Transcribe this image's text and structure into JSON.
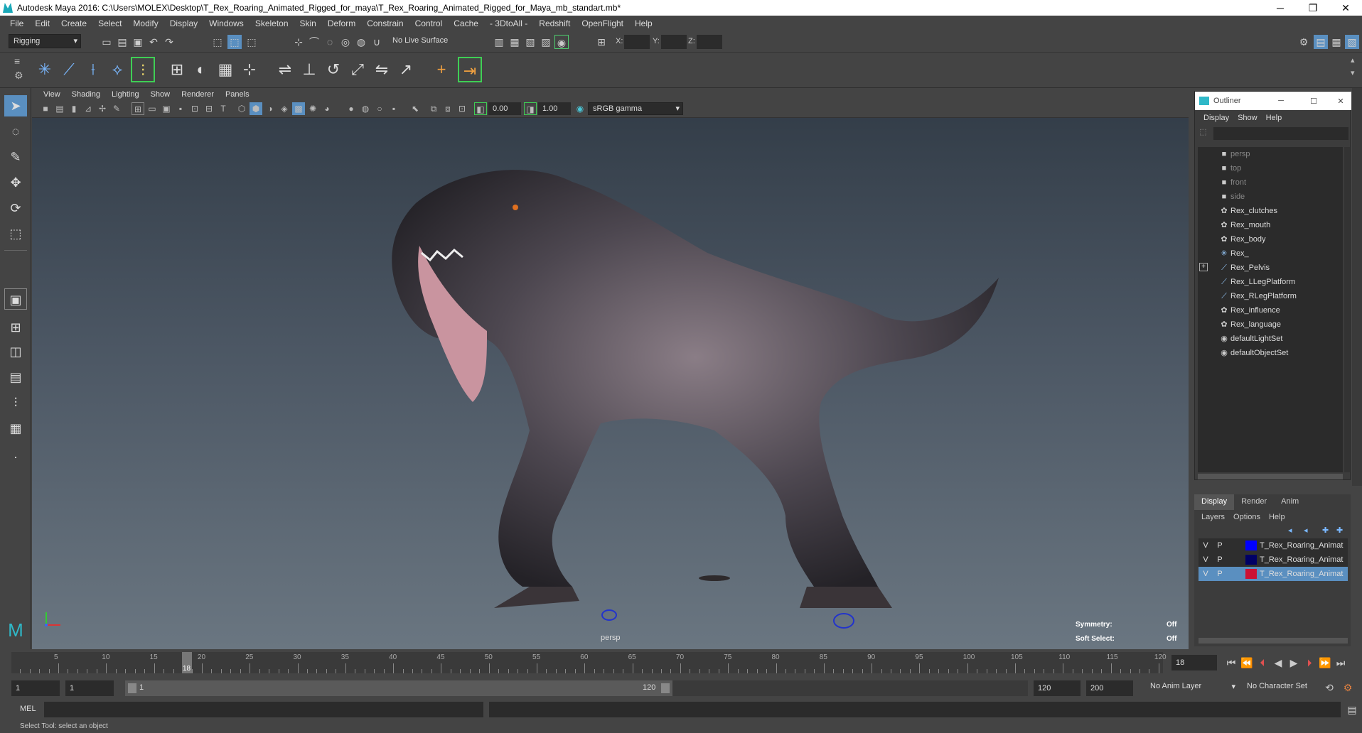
{
  "window": {
    "title": "Autodesk Maya 2016: C:\\Users\\MOLEX\\Desktop\\T_Rex_Roaring_Animated_Rigged_for_maya\\T_Rex_Roaring_Animated_Rigged_for_Maya_mb_standart.mb*",
    "minimize": "─",
    "restore": "❐",
    "close": "✕"
  },
  "menubar": [
    "File",
    "Edit",
    "Create",
    "Select",
    "Modify",
    "Display",
    "Windows",
    "Skeleton",
    "Skin",
    "Deform",
    "Constrain",
    "Control",
    "Cache",
    "- 3DtoAll -",
    "Redshift",
    "OpenFlight",
    "Help"
  ],
  "statusline": {
    "mode": "Rigging",
    "live_surface": "No Live Surface",
    "x_label": "X:",
    "y_label": "Y:",
    "z_label": "Z:"
  },
  "panel": {
    "menus": [
      "View",
      "Shading",
      "Lighting",
      "Show",
      "Renderer",
      "Panels"
    ],
    "exposure": "0.00",
    "gamma": "1.00",
    "color_space": "sRGB gamma",
    "camera_label": "persp",
    "symmetry_label": "Symmetry:",
    "symmetry_value": "Off",
    "soft_select_label": "Soft Select:",
    "soft_select_value": "Off"
  },
  "outliner": {
    "title": "Outliner",
    "menus": [
      "Display",
      "Show",
      "Help"
    ],
    "items": [
      {
        "label": "persp",
        "icon": "camera-icon",
        "dim": true
      },
      {
        "label": "top",
        "icon": "camera-icon",
        "dim": true
      },
      {
        "label": "front",
        "icon": "camera-icon",
        "dim": true
      },
      {
        "label": "side",
        "icon": "camera-icon",
        "dim": true
      },
      {
        "label": "Rex_clutches",
        "icon": "mesh-icon",
        "dim": false
      },
      {
        "label": "Rex_mouth",
        "icon": "mesh-icon",
        "dim": false
      },
      {
        "label": "Rex_body",
        "icon": "mesh-icon",
        "dim": false
      },
      {
        "label": "Rex_",
        "icon": "locator-icon",
        "dim": false
      },
      {
        "label": "Rex_Pelvis",
        "icon": "joint-icon",
        "dim": false,
        "expand": "+"
      },
      {
        "label": "Rex_LLegPlatform",
        "icon": "joint-icon",
        "dim": false
      },
      {
        "label": "Rex_RLegPlatform",
        "icon": "joint-icon",
        "dim": false
      },
      {
        "label": "Rex_influence",
        "icon": "mesh-icon",
        "dim": false
      },
      {
        "label": "Rex_language",
        "icon": "mesh-icon",
        "dim": false
      },
      {
        "label": "defaultLightSet",
        "icon": "set-icon",
        "dim": false
      },
      {
        "label": "defaultObjectSet",
        "icon": "set-icon",
        "dim": false
      }
    ]
  },
  "layers": {
    "tabs": [
      "Display",
      "Render",
      "Anim"
    ],
    "menus": [
      "Layers",
      "Options",
      "Help"
    ],
    "rows": [
      {
        "v": "V",
        "p": "P",
        "color": "#0000ff",
        "name": "T_Rex_Roaring_Animat",
        "selected": false
      },
      {
        "v": "V",
        "p": "P",
        "color": "#000066",
        "name": "T_Rex_Roaring_Animat",
        "selected": false
      },
      {
        "v": "V",
        "p": "P",
        "color": "#cc1133",
        "name": "T_Rex_Roaring_Animat",
        "selected": true
      }
    ]
  },
  "timeline": {
    "ticks": [
      "5",
      "10",
      "15",
      "20",
      "25",
      "30",
      "35",
      "40",
      "45",
      "50",
      "55",
      "60",
      "65",
      "70",
      "75",
      "80",
      "85",
      "90",
      "95",
      "100",
      "105",
      "110",
      "115",
      "120"
    ],
    "current_frame": "18",
    "current_frame_field": "18"
  },
  "range": {
    "start": "1",
    "start_inner": "1",
    "slider_start": "1",
    "slider_end": "120",
    "end_inner": "120",
    "end": "200",
    "anim_layer": "No Anim Layer",
    "character_set": "No Character Set"
  },
  "command": {
    "lang": "MEL"
  },
  "help_line": "Select Tool: select an object"
}
